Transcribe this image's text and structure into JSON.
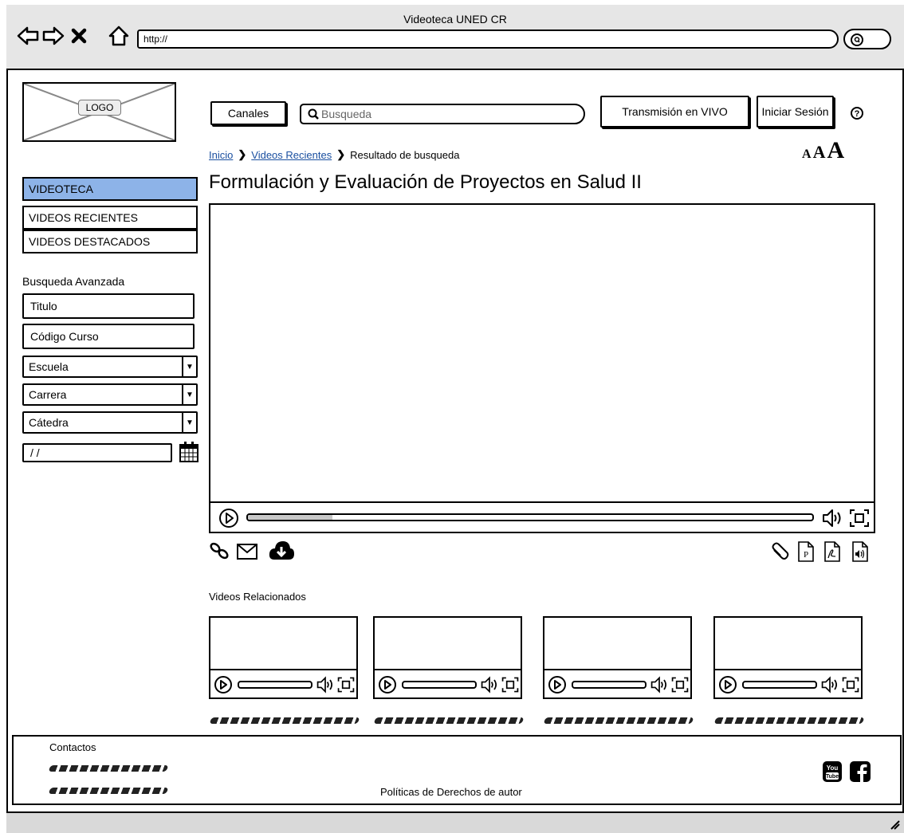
{
  "window": {
    "title": "Videoteca UNED CR"
  },
  "browser": {
    "url": "http://"
  },
  "header": {
    "logo_text": "LOGO",
    "channels_label": "Canales",
    "search_placeholder": "Busqueda",
    "live_label": "Transmisión en VIVO",
    "login_label": "Iniciar Sesión"
  },
  "breadcrumb": {
    "items": [
      {
        "label": "Inicio",
        "link": true
      },
      {
        "label": "Videos Recientes",
        "link": true
      },
      {
        "label": "Resultado de busqueda",
        "link": false
      }
    ]
  },
  "font_size_controls": [
    "A",
    "A",
    "A"
  ],
  "page_title": "Formulación y Evaluación de Proyectos en Salud II",
  "sidebar": {
    "items": [
      {
        "label": "VIDEOTECA",
        "active": true
      },
      {
        "label": "VIDEOS RECIENTES",
        "active": false
      },
      {
        "label": "VIDEOS DESTACADOS",
        "active": false
      }
    ],
    "advanced_title": "Busqueda Avanzada",
    "title_field": "Titulo",
    "course_field": "Código Curso",
    "school_select": "Escuela",
    "career_select": "Carrera",
    "chair_select": "Cátedra",
    "date_value": " / /"
  },
  "player": {
    "progress": 0.15
  },
  "related": {
    "title": "Videos Relacionados",
    "items": [
      {
        "progress": 0.0
      },
      {
        "progress": 0.0
      },
      {
        "progress": 0.0
      },
      {
        "progress": 0.0
      }
    ]
  },
  "footer": {
    "contacts_title": "Contactos",
    "rights_label": "Políticas de Derechos de autor",
    "youtube_label": "You Tube"
  },
  "colors": {
    "accent": "#8db3e8",
    "chrome": "#e6e6e6"
  }
}
